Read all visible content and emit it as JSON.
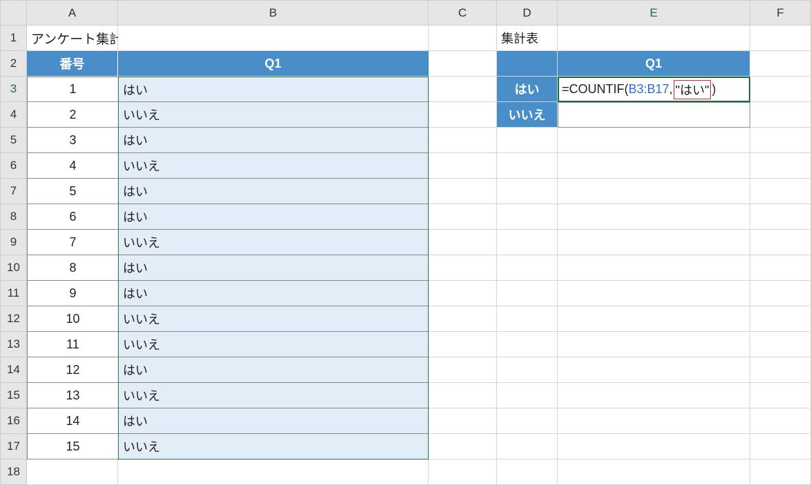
{
  "columns": [
    "A",
    "B",
    "C",
    "D",
    "E",
    "F"
  ],
  "row_count": 18,
  "active_row": 3,
  "active_col": "E",
  "title_cell": "アンケート集計表",
  "left_table": {
    "headers": [
      "番号",
      "Q1"
    ],
    "rows": [
      {
        "num": "1",
        "val": "はい"
      },
      {
        "num": "2",
        "val": "いいえ"
      },
      {
        "num": "3",
        "val": "はい"
      },
      {
        "num": "4",
        "val": "いいえ"
      },
      {
        "num": "5",
        "val": "はい"
      },
      {
        "num": "6",
        "val": "はい"
      },
      {
        "num": "7",
        "val": "いいえ"
      },
      {
        "num": "8",
        "val": "はい"
      },
      {
        "num": "9",
        "val": "はい"
      },
      {
        "num": "10",
        "val": "いいえ"
      },
      {
        "num": "11",
        "val": "いいえ"
      },
      {
        "num": "12",
        "val": "はい"
      },
      {
        "num": "13",
        "val": "いいえ"
      },
      {
        "num": "14",
        "val": "はい"
      },
      {
        "num": "15",
        "val": "いいえ"
      }
    ]
  },
  "right_table": {
    "title": "集計表",
    "header_q": "Q1",
    "labels": [
      "はい",
      "いいえ"
    ]
  },
  "formula": {
    "prefix": "=COUNTIF(",
    "ref": "B3:B17",
    "sep": ",",
    "arg2": "\"はい\"",
    "suffix": ")"
  }
}
